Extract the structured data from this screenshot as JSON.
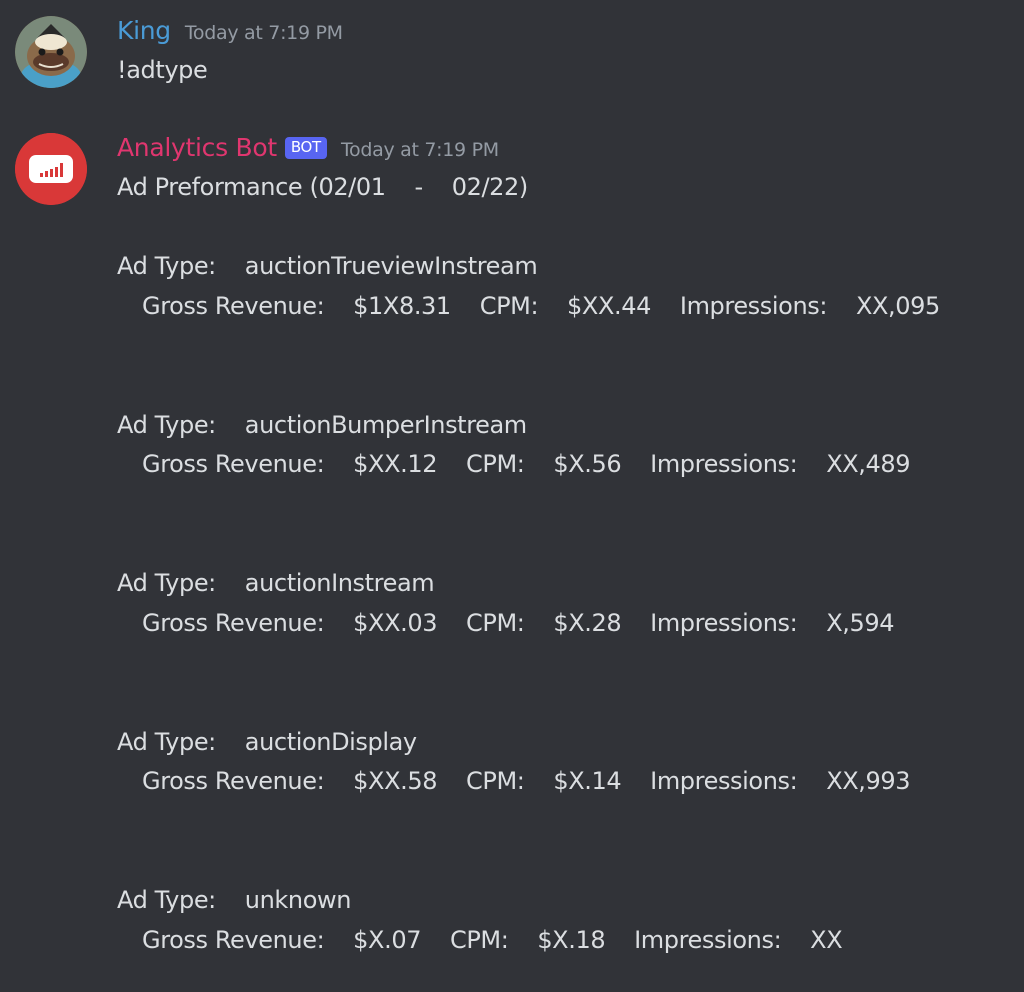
{
  "messages": [
    {
      "author": "King",
      "author_color": "#4a9bd6",
      "avatar_icon": "character-avatar-icon",
      "timestamp": "Today at 7:19 PM",
      "content": "!adtype"
    },
    {
      "author": "Analytics Bot",
      "author_color": "#e0366f",
      "avatar_icon": "analytics-chart-icon",
      "bot_tag": "BOT",
      "timestamp": "Today at 7:19 PM",
      "title": "Ad Preformance (02/01    -    02/22)",
      "ad_types": [
        {
          "label": "Ad Type:    auctionTrueviewInstream",
          "stats": "Gross Revenue:    $1X8.31    CPM:    $XX.44    Impressions:    XX,095"
        },
        {
          "label": "Ad Type:    auctionBumperInstream",
          "stats": "Gross Revenue:    $XX.12    CPM:    $X.56    Impressions:    XX,489"
        },
        {
          "label": "Ad Type:    auctionInstream",
          "stats": "Gross Revenue:    $XX.03    CPM:    $X.28    Impressions:    X,594"
        },
        {
          "label": "Ad Type:    auctionDisplay",
          "stats": "Gross Revenue:    $XX.58    CPM:    $X.14    Impressions:    XX,993"
        },
        {
          "label": "Ad Type:    unknown",
          "stats": "Gross Revenue:    $X.07    CPM:    $X.18    Impressions:    XX"
        }
      ]
    }
  ]
}
